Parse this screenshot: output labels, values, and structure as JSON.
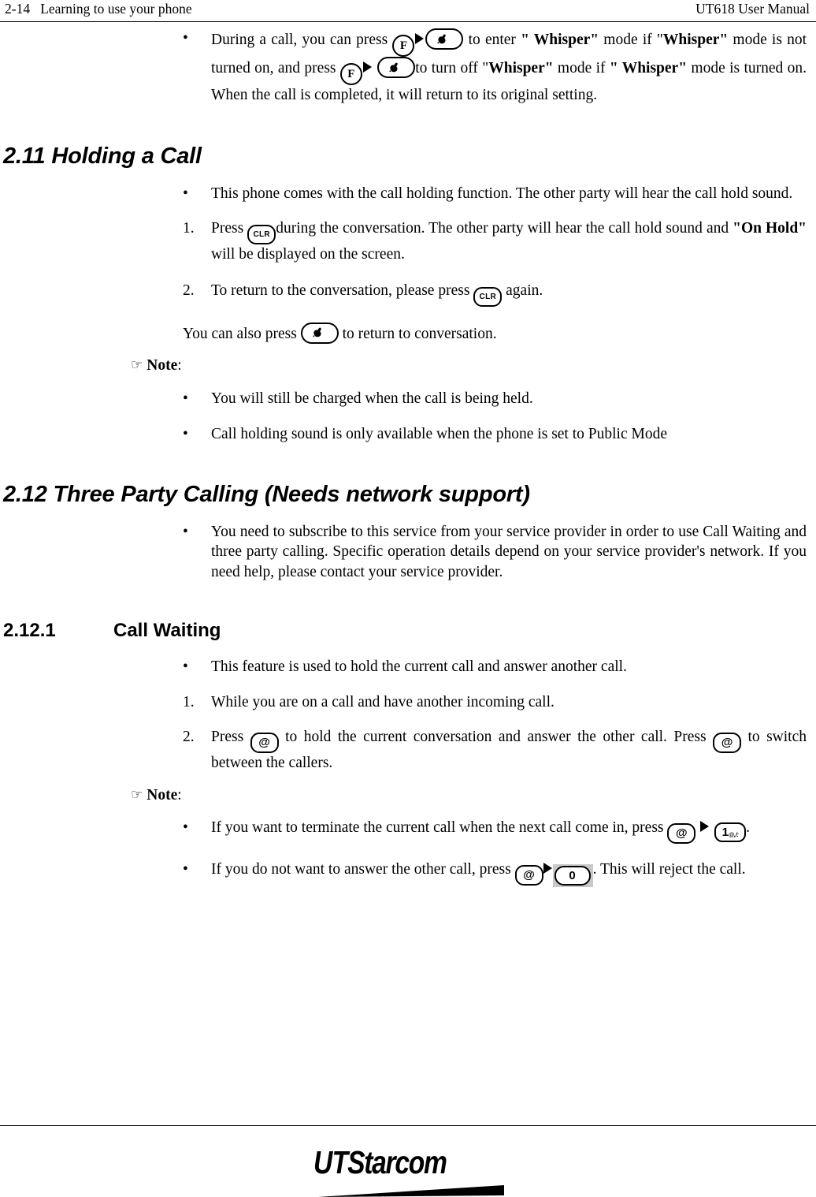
{
  "header": {
    "left": "2-14   Learning to use your phone",
    "right": "UT618 User Manual"
  },
  "keys": {
    "f": "F",
    "clr": "CLR",
    "at": "@",
    "one": "1",
    "one_sub": "@,/:",
    "zero": "0",
    "handset_label": "send-key"
  },
  "body": {
    "whisper_bullet": {
      "marker": "•",
      "t1": "During a call, you can press ",
      "t2": " to enter ",
      "t3": "\" Whisper\"",
      "t4": " mode if \"",
      "t5": "Whisper\"",
      "t6": " mode is not turned on, and press ",
      "t7": "to turn off \"",
      "t8": "Whisper\"",
      "t9": " mode if ",
      "t10": "\" Whisper\"",
      "t11": " mode is turned on. When the call is completed, it will return to its original setting."
    },
    "section_211": {
      "heading": "2.11 Holding a Call",
      "b1": {
        "marker": "•",
        "text": "This phone comes with the call holding function. The other party will hear the call hold sound."
      },
      "n1": {
        "marker": "1.",
        "t1": "Press ",
        "t2": "during the conversation. The other party will hear the call hold sound and ",
        "t3": "\"On Hold\"",
        "t4": " will be displayed on the screen."
      },
      "n2": {
        "marker": "2.",
        "t1": "To return to the conversation, please press ",
        "t2": " again."
      },
      "plain": {
        "t1": "You can also press ",
        "t2": " to return to conversation."
      },
      "note_label": "Note",
      "note_colon": ":",
      "nb1": {
        "marker": "•",
        "text": "You will still be charged when the call is being held."
      },
      "nb2": {
        "marker": "•",
        "text": "Call holding sound is only available when the phone is set to Public Mode"
      }
    },
    "section_212": {
      "heading": "2.12 Three Party Calling (Needs network support)",
      "b1": {
        "marker": "•",
        "text": "You need to subscribe to this service from your service provider in order to use Call Waiting and three party calling. Specific operation details depend on your service provider's network. If you need help, please contact your service provider."
      }
    },
    "section_2121": {
      "number": "2.12.1",
      "title": "Call Waiting",
      "b1": {
        "marker": "•",
        "text": "This feature is used to hold the current call and answer another call."
      },
      "n1": {
        "marker": "1.",
        "text": "While you are on a call and have another incoming call."
      },
      "n2": {
        "marker": "2.",
        "t1": "Press ",
        "t2": " to hold the current conversation and answer the other call. Press ",
        "t3": " to switch between the callers."
      },
      "note_label": "Note",
      "note_colon": ":",
      "nb1": {
        "marker": "•",
        "t1": "If you want to terminate the current call when the next call come in, press ",
        "t2": "."
      },
      "nb2": {
        "marker": "•",
        "t1": "If you do not want to answer the other call, press ",
        "t2": ". This will reject the call."
      }
    }
  },
  "footer": {
    "logo_ut": "UT",
    "logo_starcom": "Starcom"
  },
  "colors": {
    "ink": "#000000",
    "highlight_grey": "#c9c9c9",
    "page": "#ffffff"
  }
}
